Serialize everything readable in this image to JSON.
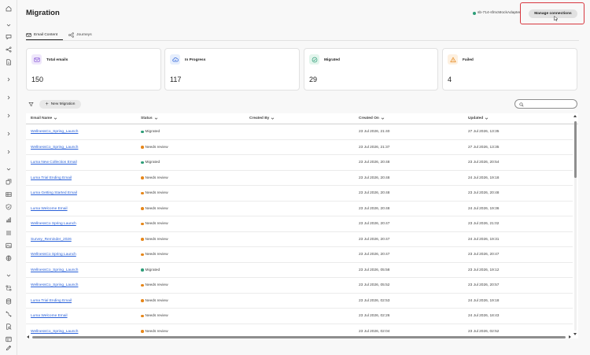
{
  "page": {
    "title": "Migration"
  },
  "header": {
    "connection_name": "sb-714-sfmcMockAdapter",
    "connection_status_color": "#2d9d78",
    "manage_button_label": "Manage connections",
    "highlight_color": "#d7373f"
  },
  "tabs": [
    {
      "label": "Email Content",
      "icon": "email-icon",
      "active": true
    },
    {
      "label": "Journeys",
      "icon": "journey-icon",
      "active": false
    }
  ],
  "cards": [
    {
      "label": "Total emails",
      "value": "150",
      "icon": "email-icon",
      "icon_color": "#8a5cd8",
      "icon_bg": "#efe7fb"
    },
    {
      "label": "In Progress",
      "value": "117",
      "icon": "cloud-sync-icon",
      "icon_color": "#2b62d9",
      "icon_bg": "#e6eefc"
    },
    {
      "label": "Migrated",
      "value": "29",
      "icon": "check-circle-icon",
      "icon_color": "#2d9d78",
      "icon_bg": "#e3f5ec"
    },
    {
      "label": "Failed",
      "value": "4",
      "icon": "alert-triangle-icon",
      "icon_color": "#e68619",
      "icon_bg": "#fdf0e0"
    }
  ],
  "toolbar": {
    "new_migration_label": "New Migration",
    "search_placeholder": ""
  },
  "table": {
    "columns": [
      "Email Name",
      "Status",
      "Created By",
      "Created On",
      "Updated"
    ],
    "status_colors": {
      "Migrated": "#2d9d78",
      "Needs review": "#e68619"
    },
    "rows": [
      {
        "name": "WellnessCo_Spring_Launch",
        "status": "Migrated",
        "created_by": "",
        "created_on": "23 Jul 2026, 21:40",
        "updated": "27 Jul 2026, 13:35"
      },
      {
        "name": "WellnessCo_Spring_Launch",
        "status": "Needs review",
        "created_by": "",
        "created_on": "23 Jul 2026, 21:37",
        "updated": "27 Jul 2026, 13:35"
      },
      {
        "name": "Luma New Collection Email",
        "status": "Migrated",
        "created_by": "",
        "created_on": "23 Jul 2026, 20:48",
        "updated": "23 Jul 2026, 20:54"
      },
      {
        "name": "Luma Trial Ending Email",
        "status": "Needs review",
        "created_by": "",
        "created_on": "23 Jul 2026, 20:48",
        "updated": "24 Jul 2026, 19:18"
      },
      {
        "name": "Luma Getting Started Email",
        "status": "Needs review",
        "created_by": "",
        "created_on": "23 Jul 2026, 20:48",
        "updated": "23 Jul 2026, 20:48"
      },
      {
        "name": "Luma Welcome Email",
        "status": "Needs review",
        "created_by": "",
        "created_on": "23 Jul 2026, 20:48",
        "updated": "24 Jul 2026, 19:36"
      },
      {
        "name": "WellnessCo Spring Launch",
        "status": "Needs review",
        "created_by": "",
        "created_on": "23 Jul 2026, 20:47",
        "updated": "23 Jul 2026, 21:02"
      },
      {
        "name": "Survey_Reminder_2026",
        "status": "Needs review",
        "created_by": "",
        "created_on": "23 Jul 2026, 20:47",
        "updated": "24 Jul 2026, 19:31"
      },
      {
        "name": "WellnessCo Spring Launch",
        "status": "Needs review",
        "created_by": "",
        "created_on": "23 Jul 2026, 20:47",
        "updated": "23 Jul 2026, 20:47"
      },
      {
        "name": "WellnessCo_Spring_Launch",
        "status": "Migrated",
        "created_by": "",
        "created_on": "23 Jul 2026, 05:58",
        "updated": "23 Jul 2026, 19:12"
      },
      {
        "name": "WellnessCo_Spring_Launch",
        "status": "Needs review",
        "created_by": "",
        "created_on": "23 Jul 2026, 05:52",
        "updated": "23 Jul 2026, 20:57"
      },
      {
        "name": "Luma Trial Ending Email",
        "status": "Needs review",
        "created_by": "",
        "created_on": "23 Jul 2026, 02:53",
        "updated": "24 Jul 2026, 19:18"
      },
      {
        "name": "Luma Welcome Email",
        "status": "Needs review",
        "created_by": "",
        "created_on": "23 Jul 2026, 02:26",
        "updated": "24 Jul 2026, 18:43"
      },
      {
        "name": "WellnessCo_Spring_Launch",
        "status": "Needs review",
        "created_by": "",
        "created_on": "23 Jul 2026, 02:04",
        "updated": "23 Jul 2026, 02:52"
      }
    ]
  },
  "rail": {
    "icons": [
      "home-icon",
      "chevron-down-icon",
      "messages-icon",
      "flow-icon",
      "document-icon",
      "chevron-right-icon",
      "chevron-right-icon",
      "chevron-right-icon",
      "chevron-right-icon",
      "chevron-right-icon",
      "chevron-down-icon",
      "copy-icon",
      "table-icon",
      "shield-icon",
      "bar-chart-icon",
      "list-icon",
      "image-icon",
      "globe-icon",
      "chevron-down-icon",
      "route-icon",
      "database-icon",
      "connection-icon",
      "search-doc-icon",
      "layout-icon",
      "edit-icon"
    ]
  }
}
